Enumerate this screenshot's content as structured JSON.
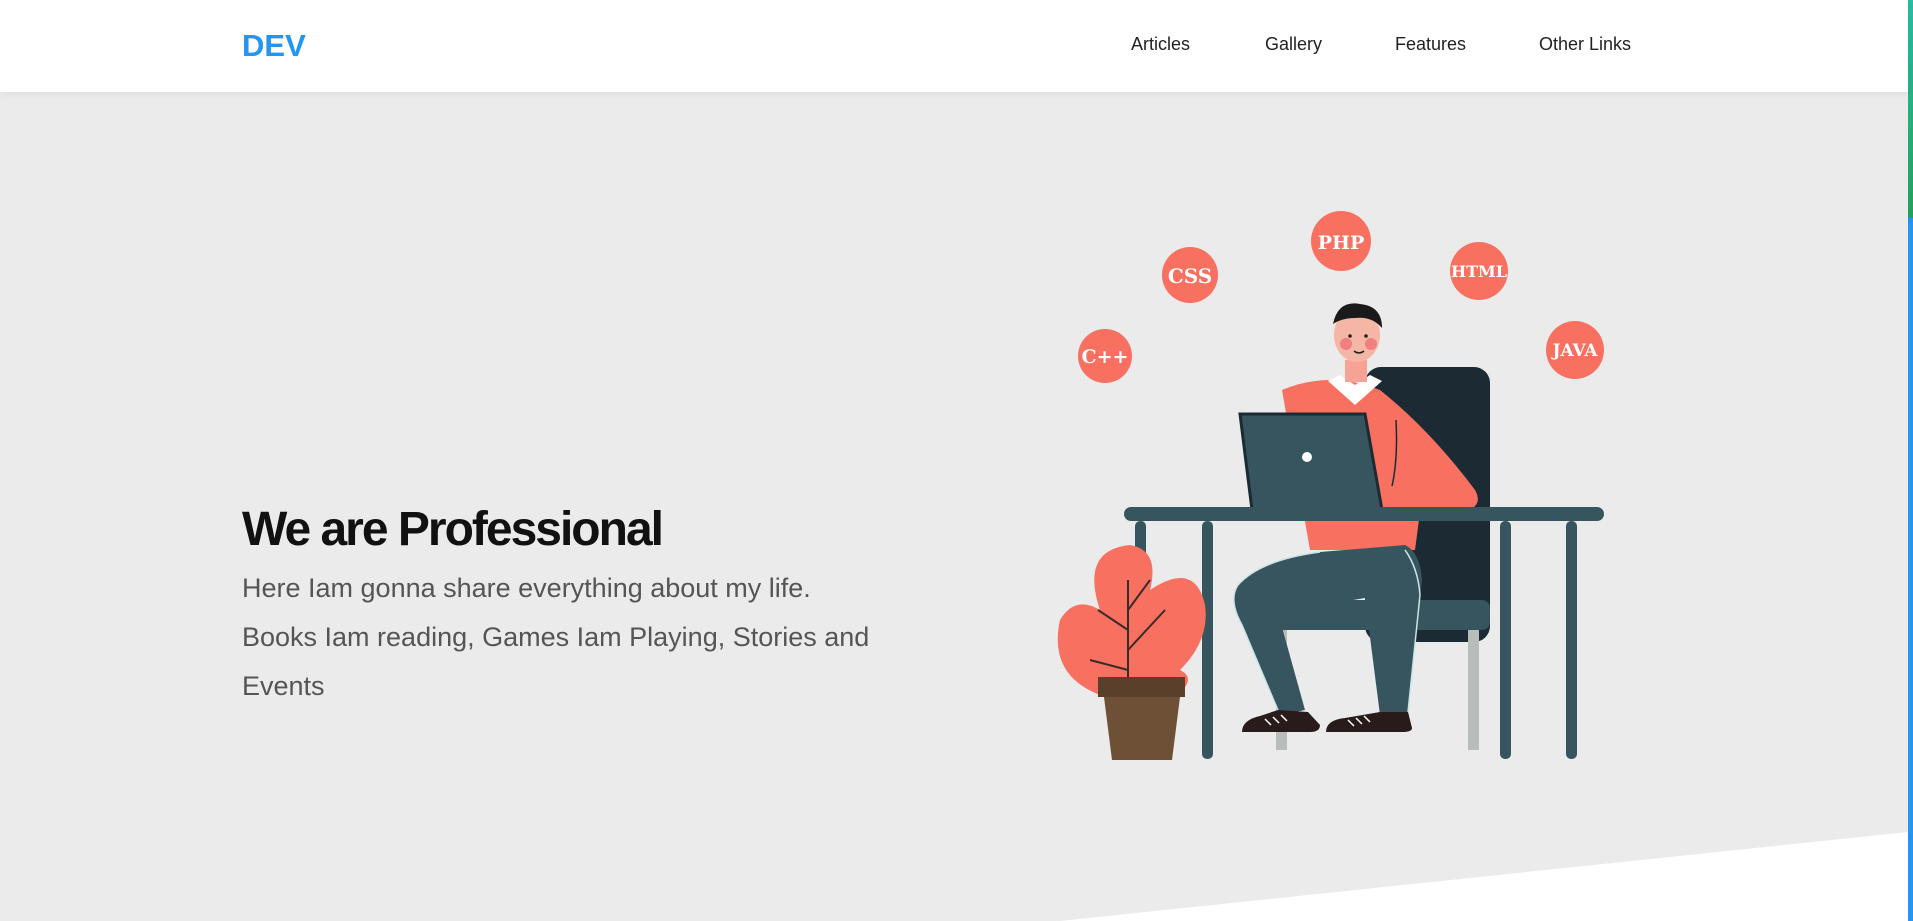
{
  "header": {
    "logo": "DEV",
    "nav": [
      "Articles",
      "Gallery",
      "Features",
      "Other Links"
    ]
  },
  "hero": {
    "title": "We are Professional",
    "text": "Here Iam gonna share everything about my life. Books Iam reading, Games Iam Playing, Stories and Events",
    "bubbles": [
      "C++",
      "CSS",
      "PHP",
      "HTML",
      "JAVA"
    ]
  },
  "colors": {
    "accent": "#2196f3",
    "hero_bg": "#ebebeb",
    "coral": "#f87060",
    "dark_teal": "#37555f"
  }
}
